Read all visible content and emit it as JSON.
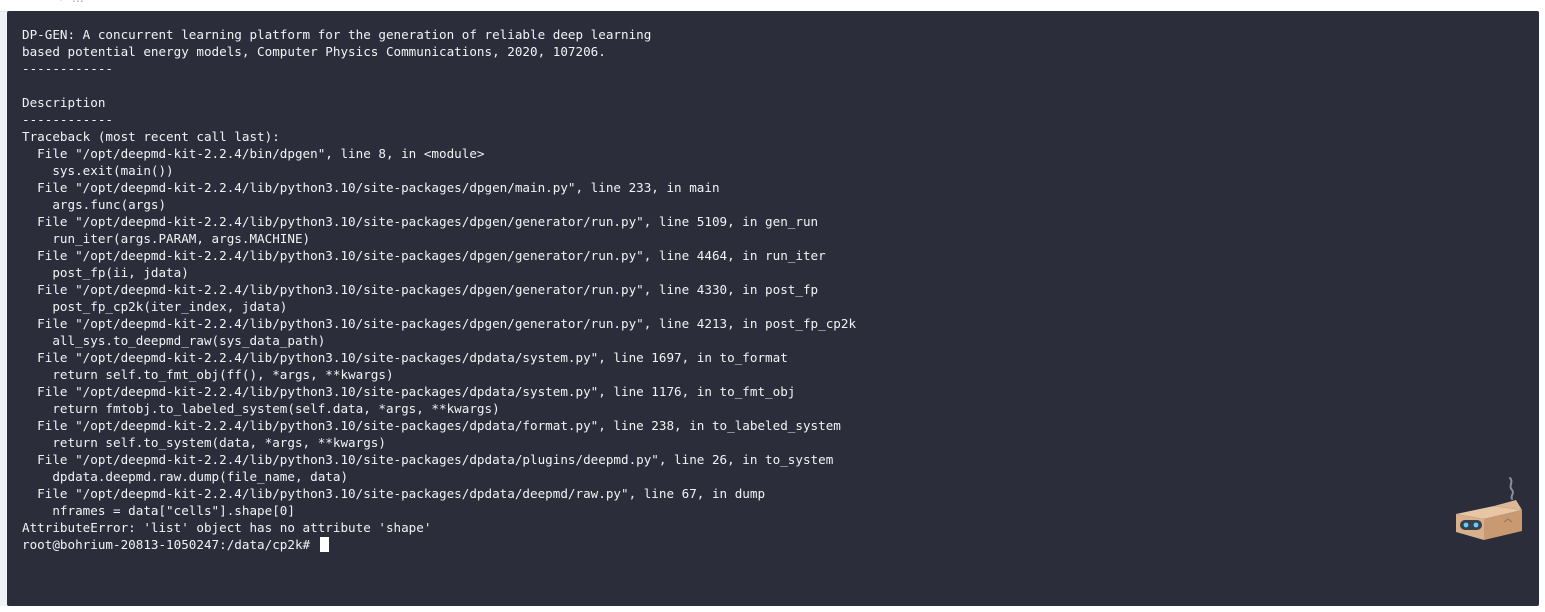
{
  "top_fragment": "← …",
  "terminal": {
    "lines": [
      "DP-GEN: A concurrent learning platform for the generation of reliable deep learning",
      "based potential energy models, Computer Physics Communications, 2020, 107206.",
      "------------",
      "",
      "Description",
      "------------",
      "Traceback (most recent call last):",
      "  File \"/opt/deepmd-kit-2.2.4/bin/dpgen\", line 8, in <module>",
      "    sys.exit(main())",
      "  File \"/opt/deepmd-kit-2.2.4/lib/python3.10/site-packages/dpgen/main.py\", line 233, in main",
      "    args.func(args)",
      "  File \"/opt/deepmd-kit-2.2.4/lib/python3.10/site-packages/dpgen/generator/run.py\", line 5109, in gen_run",
      "    run_iter(args.PARAM, args.MACHINE)",
      "  File \"/opt/deepmd-kit-2.2.4/lib/python3.10/site-packages/dpgen/generator/run.py\", line 4464, in run_iter",
      "    post_fp(ii, jdata)",
      "  File \"/opt/deepmd-kit-2.2.4/lib/python3.10/site-packages/dpgen/generator/run.py\", line 4330, in post_fp",
      "    post_fp_cp2k(iter_index, jdata)",
      "  File \"/opt/deepmd-kit-2.2.4/lib/python3.10/site-packages/dpgen/generator/run.py\", line 4213, in post_fp_cp2k",
      "    all_sys.to_deepmd_raw(sys_data_path)",
      "  File \"/opt/deepmd-kit-2.2.4/lib/python3.10/site-packages/dpdata/system.py\", line 1697, in to_format",
      "    return self.to_fmt_obj(ff(), *args, **kwargs)",
      "  File \"/opt/deepmd-kit-2.2.4/lib/python3.10/site-packages/dpdata/system.py\", line 1176, in to_fmt_obj",
      "    return fmtobj.to_labeled_system(self.data, *args, **kwargs)",
      "  File \"/opt/deepmd-kit-2.2.4/lib/python3.10/site-packages/dpdata/format.py\", line 238, in to_labeled_system",
      "    return self.to_system(data, *args, **kwargs)",
      "  File \"/opt/deepmd-kit-2.2.4/lib/python3.10/site-packages/dpdata/plugins/deepmd.py\", line 26, in to_system",
      "    dpdata.deepmd.raw.dump(file_name, data)",
      "  File \"/opt/deepmd-kit-2.2.4/lib/python3.10/site-packages/dpdata/deepmd/raw.py\", line 67, in dump",
      "    nframes = data[\"cells\"].shape[0]",
      "AttributeError: 'list' object has no attribute 'shape'"
    ],
    "prompt": "root@bohrium-20813-1050247:/data/cp2k# "
  },
  "colors": {
    "terminal_bg": "#2b2d3a",
    "terminal_fg": "#f2f3f5",
    "page_bg": "#ffffff"
  },
  "icons": {
    "assistant": "robot-box-icon"
  }
}
